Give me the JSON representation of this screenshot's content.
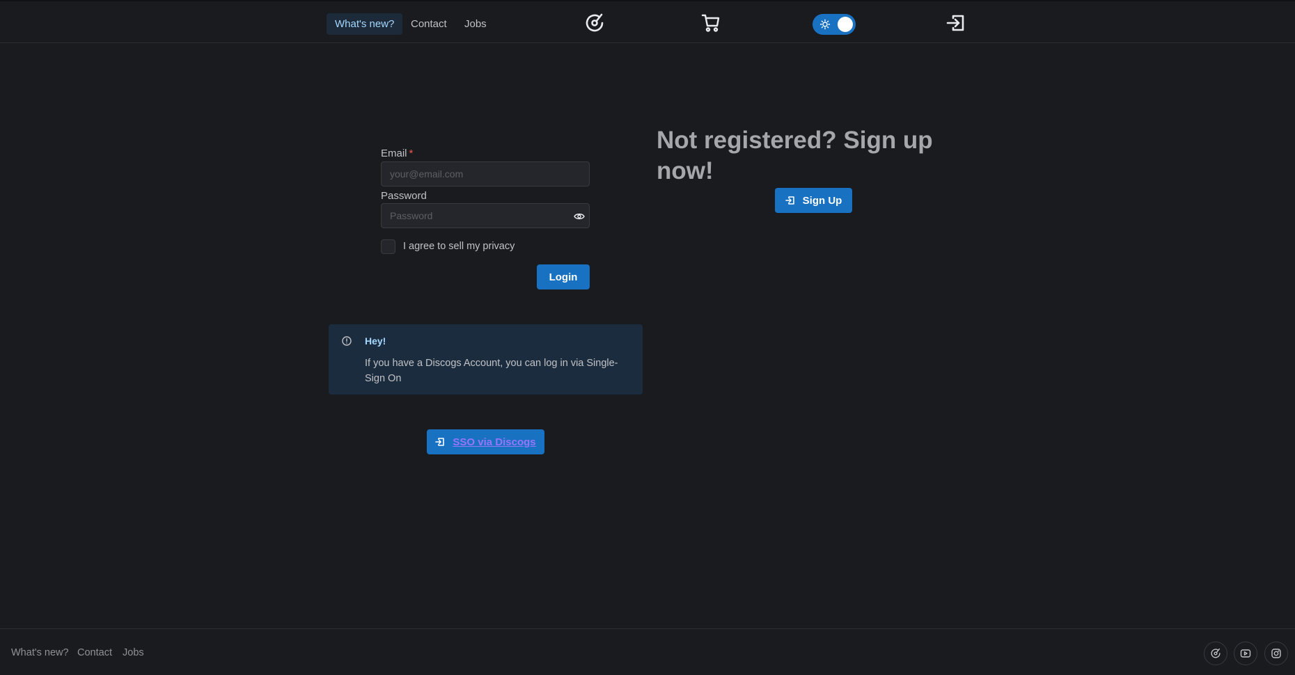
{
  "header": {
    "nav": [
      "What's new?",
      "Contact",
      "Jobs"
    ],
    "active_nav": "What's new?",
    "icons": [
      "logo-icon",
      "cart-icon",
      "sun-icon",
      "login-icon"
    ],
    "theme_toggle_on": true
  },
  "login": {
    "email_label": "Email",
    "email_required_mark": "*",
    "email_placeholder": "your@email.com",
    "password_label": "Password",
    "password_placeholder": "Password",
    "checkbox_label": "I agree to sell my privacy",
    "login_button": "Login"
  },
  "signup": {
    "title": "Not registered? Sign up now!",
    "button": "Sign Up"
  },
  "alert": {
    "title": "Hey!",
    "body": "If you have a Discogs Account, you can log in via Single-Sign On"
  },
  "sso": {
    "button": "SSO via Discogs"
  },
  "footer": {
    "links": [
      "What's new?",
      "Contact",
      "Jobs"
    ],
    "social_icons": [
      "logo-icon",
      "youtube-icon",
      "instagram-icon"
    ]
  },
  "colors": {
    "background": "#1a1b1e",
    "primary": "#1971c2",
    "alert_bg": "#1c2c3f",
    "link_purple": "#9775fa"
  }
}
